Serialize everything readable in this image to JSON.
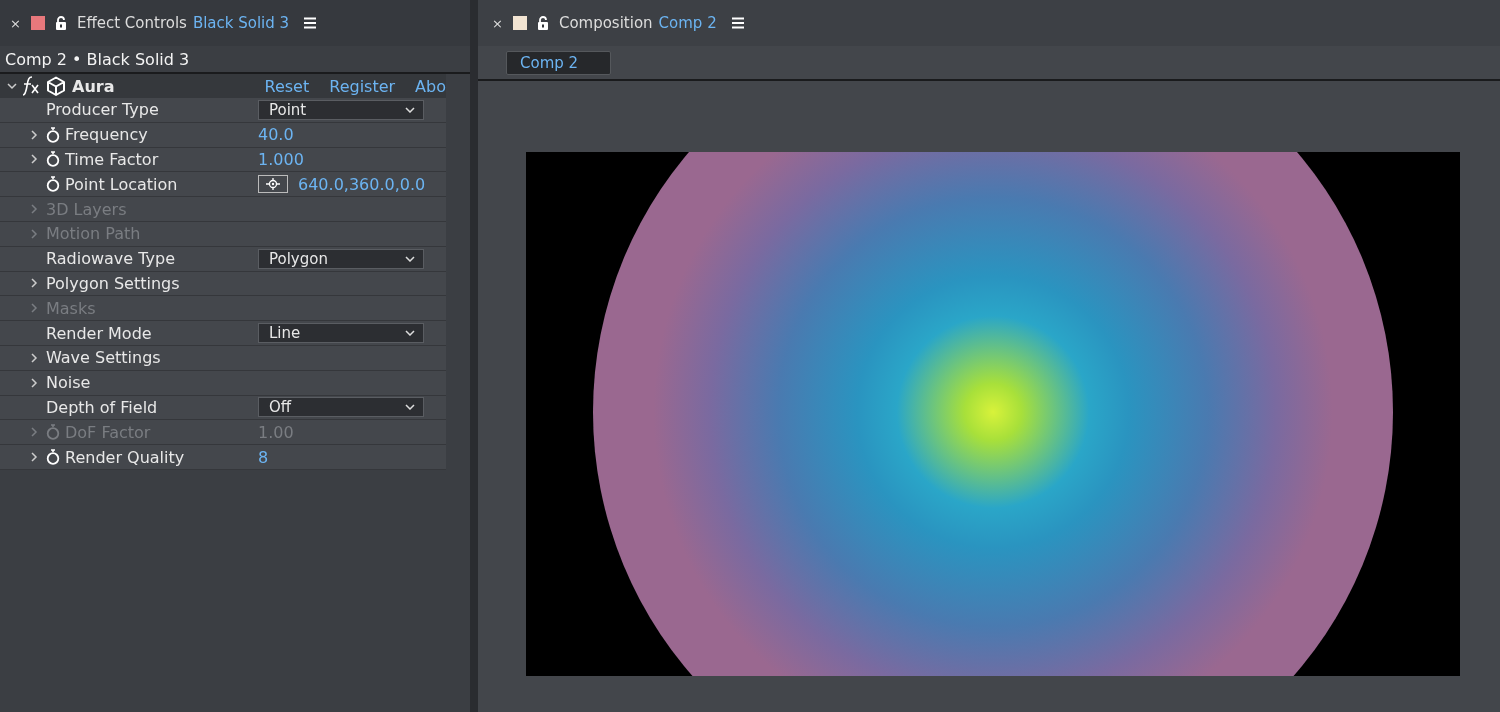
{
  "panels": [
    {
      "close": "×",
      "color": "#e8787c",
      "title": "Effect Controls",
      "subject": "Black Solid 3"
    },
    {
      "close": "×",
      "color": "#f2e4d2",
      "title": "Composition",
      "subject": "Comp 2"
    }
  ],
  "effect_controls": {
    "layer_path": "Comp 2 • Black Solid 3",
    "effect": {
      "name": "Aura",
      "expanded": true,
      "links": [
        "Reset",
        "Register",
        "Abo"
      ]
    },
    "properties": [
      {
        "label": "Producer Type",
        "kind": "dropdown",
        "value": "Point",
        "expandable": false,
        "stopwatch": false,
        "disabled": false
      },
      {
        "label": "Frequency",
        "kind": "number",
        "value": "40.0",
        "expandable": true,
        "stopwatch": true,
        "disabled": false
      },
      {
        "label": "Time Factor",
        "kind": "number",
        "value": "1.000",
        "expandable": true,
        "stopwatch": true,
        "disabled": false
      },
      {
        "label": "Point Location",
        "kind": "point",
        "value": "640.0,360.0,0.0",
        "expandable": false,
        "stopwatch": true,
        "disabled": false
      },
      {
        "label": "3D Layers",
        "kind": "group",
        "expandable": true,
        "stopwatch": false,
        "disabled": true
      },
      {
        "label": "Motion Path",
        "kind": "group",
        "expandable": true,
        "stopwatch": false,
        "disabled": true
      },
      {
        "label": "Radiowave Type",
        "kind": "dropdown",
        "value": "Polygon",
        "expandable": false,
        "stopwatch": false,
        "disabled": false
      },
      {
        "label": "Polygon Settings",
        "kind": "group",
        "expandable": true,
        "stopwatch": false,
        "disabled": false
      },
      {
        "label": "Masks",
        "kind": "group",
        "expandable": true,
        "stopwatch": false,
        "disabled": true
      },
      {
        "label": "Render Mode",
        "kind": "dropdown",
        "value": "Line",
        "expandable": false,
        "stopwatch": false,
        "disabled": false
      },
      {
        "label": "Wave Settings",
        "kind": "group",
        "expandable": true,
        "stopwatch": false,
        "disabled": false
      },
      {
        "label": "Noise",
        "kind": "group",
        "expandable": true,
        "stopwatch": false,
        "disabled": false
      },
      {
        "label": "Depth of Field",
        "kind": "dropdown",
        "value": "Off",
        "expandable": false,
        "stopwatch": false,
        "disabled": false
      },
      {
        "label": "DoF Factor",
        "kind": "number",
        "value": "1.00",
        "expandable": true,
        "stopwatch": true,
        "disabled": true
      },
      {
        "label": "Render Quality",
        "kind": "number",
        "value": "8",
        "expandable": true,
        "stopwatch": true,
        "disabled": false
      }
    ]
  },
  "composition": {
    "tabs": [
      {
        "label": "Comp 2",
        "selected": true
      }
    ]
  }
}
